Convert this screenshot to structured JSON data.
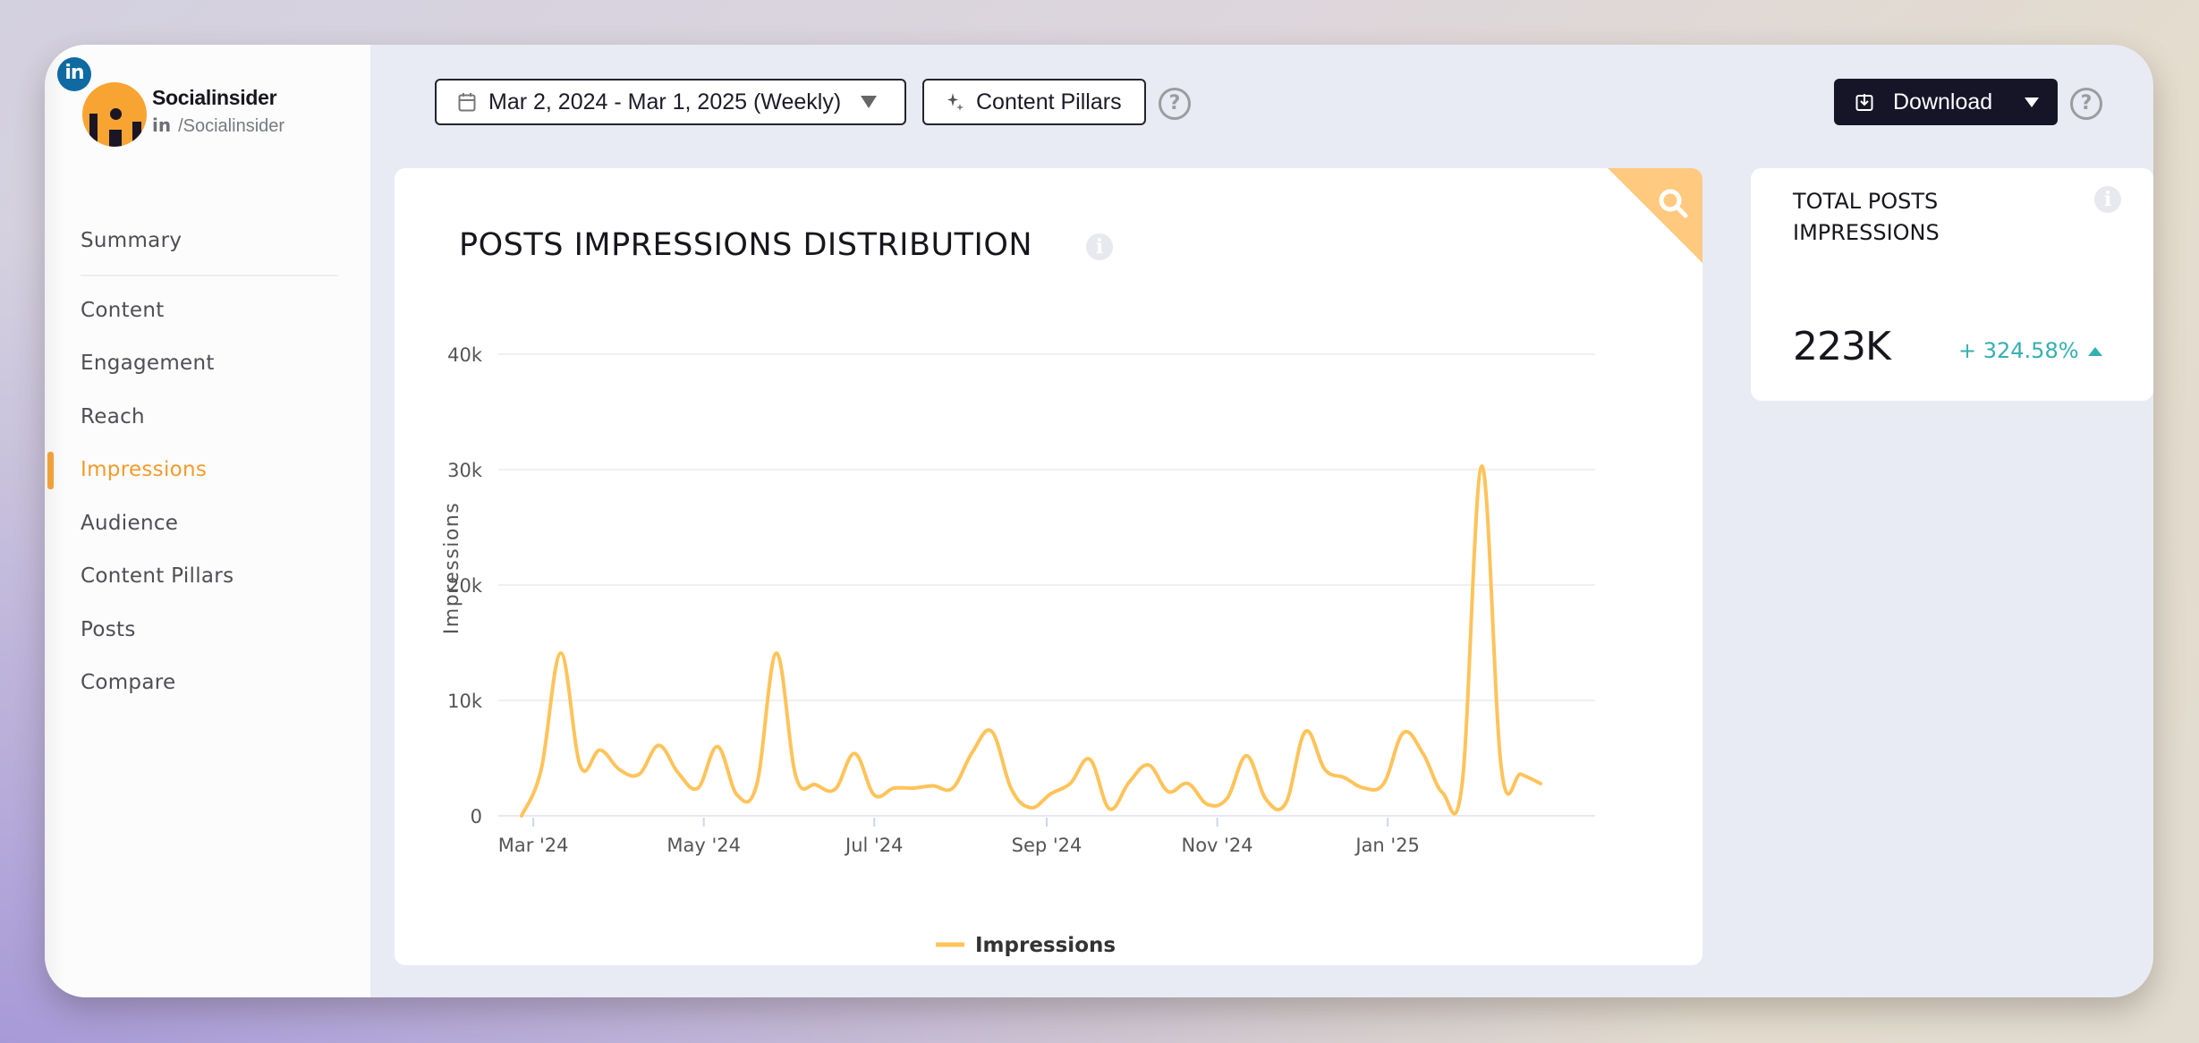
{
  "profile": {
    "name": "Socialinsider",
    "network_badge": "in",
    "handle_network": "in",
    "handle": "/Socialinsider",
    "colors": {
      "avatar": "#f8a433",
      "linkedin": "#0e6aa1"
    }
  },
  "sidebar": {
    "items": [
      {
        "label": "Summary",
        "active": false
      },
      {
        "label": "Content",
        "active": false
      },
      {
        "label": "Engagement",
        "active": false
      },
      {
        "label": "Reach",
        "active": false
      },
      {
        "label": "Impressions",
        "active": true
      },
      {
        "label": "Audience",
        "active": false
      },
      {
        "label": "Content Pillars",
        "active": false
      },
      {
        "label": "Posts",
        "active": false
      },
      {
        "label": "Compare",
        "active": false
      }
    ],
    "active_color": "#f39b2b"
  },
  "toolbar": {
    "date_range": "Mar 2, 2024 - Mar 1, 2025 (Weekly)",
    "date_icon": "calendar-icon",
    "content_pillars_label": "Content Pillars",
    "content_pillars_icon": "sparkle-icon",
    "help_glyph": "?",
    "download_label": "Download",
    "download_icon": "download-icon"
  },
  "chart_card": {
    "title": "POSTS IMPRESSIONS DISTRIBUTION",
    "info_glyph": "i",
    "corner_icon": "search-icon"
  },
  "kpi": {
    "title": "TOTAL POSTS IMPRESSIONS",
    "value": "223K",
    "change": "+ 324.58%",
    "change_direction": "up",
    "change_color": "#35b0b0",
    "info_glyph": "i"
  },
  "chart_data": {
    "type": "line",
    "title": "POSTS IMPRESSIONS DISTRIBUTION",
    "xlabel": "",
    "ylabel": "Impressions",
    "ylim": [
      0,
      40000
    ],
    "yticks": [
      0,
      10000,
      20000,
      30000,
      40000
    ],
    "ytick_labels": [
      "0",
      "10k",
      "20k",
      "30k",
      "40k"
    ],
    "xtick_labels": [
      "Mar '24",
      "May '24",
      "Jul '24",
      "Sep '24",
      "Nov '24",
      "Jan '25"
    ],
    "xtick_week_index": [
      0.6,
      9.3,
      18.0,
      26.8,
      35.5,
      44.2
    ],
    "grid": true,
    "legend_position": "bottom-center",
    "line_color": "#ffc35a",
    "series": [
      {
        "name": "Impressions",
        "values": [
          0,
          4000,
          14100,
          4300,
          5700,
          4000,
          3600,
          6100,
          3700,
          2400,
          6000,
          1800,
          2700,
          14100,
          3400,
          2700,
          2300,
          5400,
          1800,
          2400,
          2400,
          2600,
          2400,
          5500,
          7300,
          2300,
          700,
          1900,
          2800,
          4900,
          600,
          2900,
          4400,
          2100,
          2800,
          1000,
          1500,
          5200,
          1400,
          1100,
          7300,
          4000,
          3300,
          2400,
          2800,
          7200,
          5400,
          2000,
          2800,
          30300,
          4100,
          3600,
          2800
        ]
      }
    ]
  }
}
